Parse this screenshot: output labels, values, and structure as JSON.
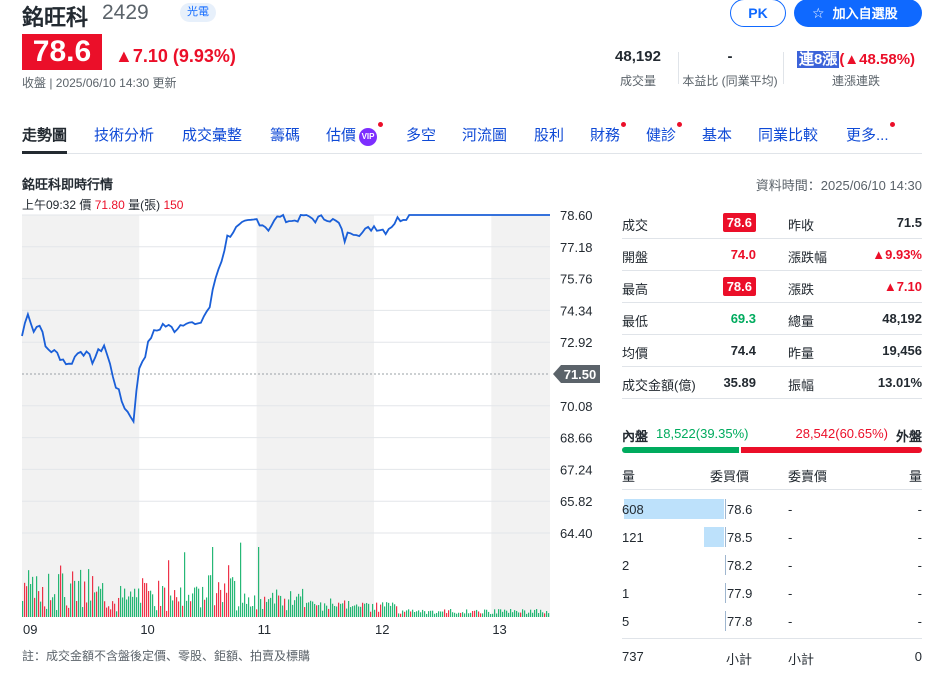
{
  "header": {
    "name": "銘旺科",
    "code": "2429",
    "sector": "光電",
    "pk_label": "PK",
    "watchlist_label": "加入自選股",
    "price": "78.6",
    "change": "▲7.10 (9.93%)",
    "close_note": "收盤 | 2025/06/10 14:30 更新"
  },
  "stats": {
    "volume_value": "48,192",
    "volume_label": "成交量",
    "pe_value": "-",
    "pe_label": "本益比 (同業平均)",
    "streak_tag": "連8漲",
    "streak_pct": "(▲48.58%)",
    "streak_label": "連漲連跌"
  },
  "tabs": [
    "走勢圖",
    "技術分析",
    "成交彙整",
    "籌碼",
    "估價",
    "多空",
    "河流圖",
    "股利",
    "財務",
    "健診",
    "基本",
    "同業比較",
    "更多..."
  ],
  "vip_badge": "VIP",
  "chart_section": {
    "title": "銘旺科即時行情",
    "data_time": "資料時間：2025/06/10 14:30",
    "tick_time": "上午09:32",
    "tick_price_label": "價",
    "tick_price": "71.80",
    "tick_vol_label": "量(張)",
    "tick_vol": "150",
    "note": "註：成交金額不含盤後定價、零股、鉅額、拍賣及標購"
  },
  "chart_data": {
    "type": "line",
    "x_ticks": [
      "09",
      "10",
      "11",
      "12",
      "13"
    ],
    "y_ticks": [
      "78.60",
      "77.18",
      "75.76",
      "74.34",
      "72.92",
      "71.50",
      "70.08",
      "68.66",
      "67.24",
      "65.82",
      "64.40"
    ],
    "ylim": [
      64.4,
      78.6
    ],
    "reference_price": "71.50",
    "series": [
      {
        "time_hours": [
          9.0,
          9.05,
          9.1,
          9.15,
          9.2,
          9.3,
          9.4,
          9.5,
          9.6,
          9.7,
          9.8,
          9.85,
          9.9,
          9.95,
          10.0,
          10.05,
          10.1,
          10.2,
          10.3,
          10.4,
          10.5,
          10.55,
          10.6,
          10.65,
          10.7,
          10.75,
          10.8,
          10.9,
          11.0,
          11.1,
          11.2,
          11.3,
          11.4,
          11.5,
          11.6,
          11.7,
          11.75,
          11.8,
          11.9,
          12.0,
          12.1,
          12.2,
          12.3,
          12.5,
          13.0,
          13.5
        ],
        "price": [
          73.2,
          74.3,
          73.4,
          73.8,
          72.7,
          72.4,
          71.9,
          72.6,
          72.1,
          72.8,
          71.0,
          70.3,
          69.8,
          69.5,
          71.8,
          72.4,
          73.2,
          73.7,
          73.5,
          73.9,
          73.6,
          74.1,
          74.5,
          75.8,
          76.6,
          77.6,
          77.9,
          78.2,
          78.4,
          78.0,
          78.6,
          78.3,
          78.6,
          78.4,
          78.5,
          78.2,
          77.5,
          77.9,
          77.8,
          78.1,
          77.9,
          78.4,
          78.6,
          78.6,
          78.6,
          78.6
        ]
      }
    ],
    "volume_note": "Per-minute volume bars (張)"
  },
  "quote": {
    "rows": [
      {
        "l1": "成交",
        "v1": "78.6",
        "l2": "昨收",
        "v2": "71.5"
      },
      {
        "l1": "開盤",
        "v1": "74.0",
        "l2": "漲跌幅",
        "v2": "▲9.93%"
      },
      {
        "l1": "最高",
        "v1": "78.6",
        "l2": "漲跌",
        "v2": "▲7.10"
      },
      {
        "l1": "最低",
        "v1": "69.3",
        "l2": "總量",
        "v2": "48,192"
      },
      {
        "l1": "均價",
        "v1": "74.4",
        "l2": "昨量",
        "v2": "19,456"
      },
      {
        "l1": "成交金額(億)",
        "v1": "35.89",
        "l2": "振幅",
        "v2": "13.01%"
      }
    ]
  },
  "inner_outer": {
    "inner_label": "內盤",
    "inner_value": "18,522(39.35%)",
    "outer_value": "28,542(60.65%)",
    "outer_label": "外盤",
    "inner_ratio": 0.3935
  },
  "order_book": {
    "head_qty": "量",
    "head_bid": "委買價",
    "head_ask": "委賣價",
    "head_qty2": "量",
    "rows": [
      {
        "qty": "608",
        "bid": "78.6",
        "ask": "-",
        "qty2": "-",
        "fill": 1.0
      },
      {
        "qty": "121",
        "bid": "78.5",
        "ask": "-",
        "qty2": "-",
        "fill": 0.2
      },
      {
        "qty": "2",
        "bid": "78.2",
        "ask": "-",
        "qty2": "-",
        "fill": 0.0
      },
      {
        "qty": "1",
        "bid": "77.9",
        "ask": "-",
        "qty2": "-",
        "fill": 0.0
      },
      {
        "qty": "5",
        "bid": "77.8",
        "ask": "-",
        "qty2": "-",
        "fill": 0.0
      }
    ],
    "foot_qty": "737",
    "foot_label": "小計",
    "foot_label2": "小計",
    "foot_qty2": "0"
  },
  "colors": {
    "up": "#eb0f29",
    "down": "#00ab5e",
    "accent": "#0f69ff",
    "line": "#1a5fd8"
  }
}
